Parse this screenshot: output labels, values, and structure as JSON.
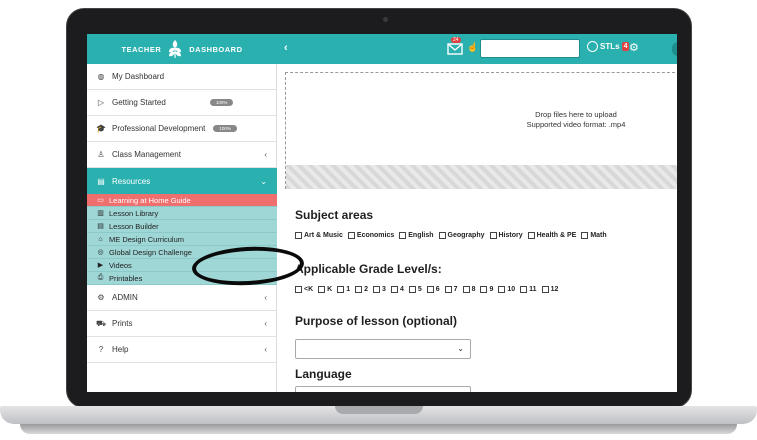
{
  "header": {
    "brand_left": "TEACHER",
    "brand_right": "DASHBOARD",
    "collapse_glyph": "‹",
    "mail_badge": "24",
    "stls_label": "STLs",
    "stls_badge": "4",
    "gear_glyph": "⚙",
    "hand_glyph": "☝"
  },
  "sidebar": {
    "items": [
      {
        "label": "My Dashboard",
        "icon": "dashboard-icon",
        "glyph": "◍"
      },
      {
        "label": "Getting Started",
        "icon": "play-icon",
        "glyph": "▷",
        "pill": "100%"
      },
      {
        "label": "Professional Development",
        "icon": "graduation-cap-icon",
        "glyph": "🎓",
        "pill": "100%"
      },
      {
        "label": "Class Management",
        "icon": "users-icon",
        "glyph": "♙",
        "chevron": "‹"
      },
      {
        "label": "Resources",
        "icon": "book-icon",
        "glyph": "▤",
        "chevron": "⌄"
      }
    ],
    "sub_items": [
      {
        "label": "Learning at Home Guide",
        "icon": "laptop-icon",
        "glyph": "▭"
      },
      {
        "label": "Lesson Library",
        "icon": "library-icon",
        "glyph": "▥"
      },
      {
        "label": "Lesson Builder",
        "icon": "builder-icon",
        "glyph": "▤"
      },
      {
        "label": "ME Design Curriculum",
        "icon": "building-icon",
        "glyph": "⌂"
      },
      {
        "label": "Global Design Challenge",
        "icon": "globe-icon",
        "glyph": "◎"
      },
      {
        "label": "Videos",
        "icon": "video-icon",
        "glyph": "▶"
      },
      {
        "label": "Printables",
        "icon": "printer-icon",
        "glyph": "⎙"
      }
    ],
    "bottom_items": [
      {
        "label": "ADMIN",
        "icon": "admin-icon",
        "glyph": "⚙",
        "chevron": "‹"
      },
      {
        "label": "Prints",
        "icon": "cart-icon",
        "glyph": "⛟",
        "chevron": "‹"
      },
      {
        "label": "Help",
        "icon": "help-icon",
        "glyph": "?",
        "chevron": "‹"
      }
    ]
  },
  "dropzone": {
    "line1": "Drop files here to upload",
    "line2": "Supported video format: .mp4"
  },
  "subject_areas": {
    "title": "Subject areas",
    "options": [
      "Art & Music",
      "Economics",
      "English",
      "Geography",
      "History",
      "Health & PE",
      "Math"
    ]
  },
  "grade_levels": {
    "title": "Applicable Grade Level/s:",
    "options": [
      "<K",
      "K",
      "1",
      "2",
      "3",
      "4",
      "5",
      "6",
      "7",
      "8",
      "9",
      "10",
      "11",
      "12"
    ]
  },
  "purpose": {
    "title": "Purpose of lesson (optional)",
    "value": ""
  },
  "language": {
    "title": "Language"
  },
  "colors": {
    "teal": "#2bb0b0",
    "highlight_red": "#ef6f6f",
    "submenu_teal": "#9fd6d6"
  }
}
